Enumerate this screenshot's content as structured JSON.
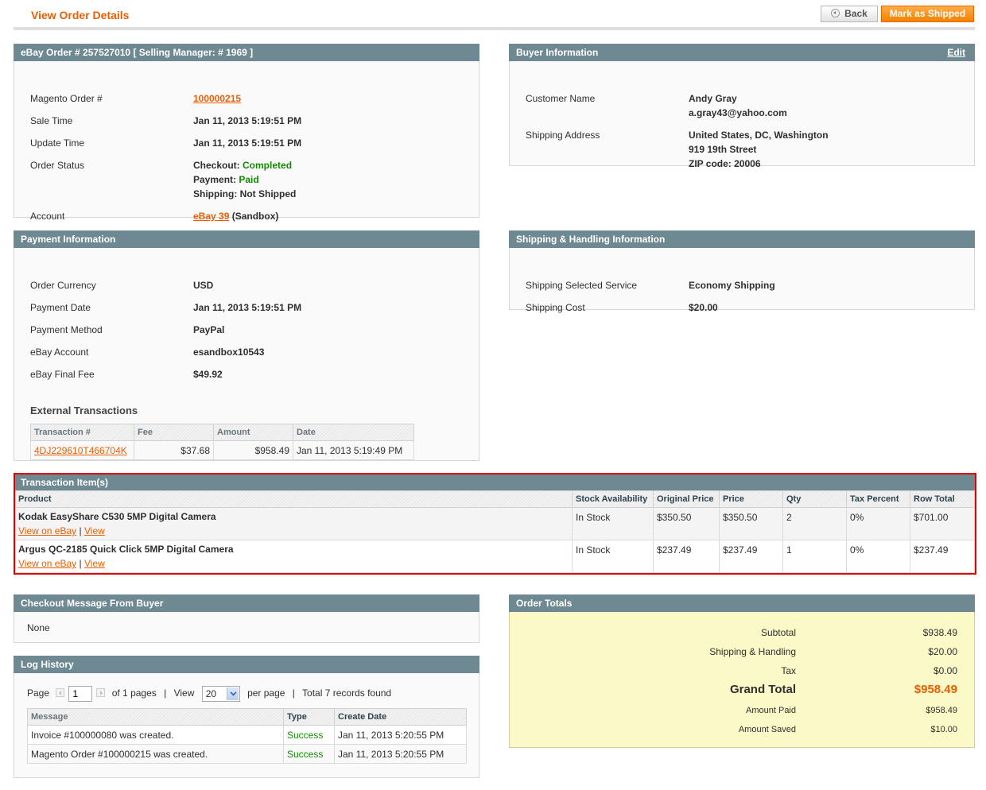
{
  "header": {
    "title": "View Order Details",
    "back_label": "Back",
    "mark_shipped_label": "Mark as Shipped"
  },
  "ebay_order": {
    "title": "eBay Order # 257527010 [ Selling Manager: # 1969 ]",
    "rows": [
      {
        "label": "Magento Order #",
        "value": "100000215"
      },
      {
        "label": "Sale Time",
        "value": "Jan 11, 2013 5:19:51 PM"
      },
      {
        "label": "Update Time",
        "value": "Jan 11, 2013 5:19:51 PM"
      },
      {
        "label": "Order Status"
      },
      {
        "label": "Account"
      }
    ],
    "status": {
      "checkout_label": "Checkout:",
      "checkout_value": "Completed",
      "payment_label": "Payment:",
      "payment_value": "Paid",
      "shipping_label": "Shipping:",
      "shipping_value": "Not Shipped"
    },
    "account_link": "eBay 39",
    "account_mode": "(Sandbox)"
  },
  "buyer": {
    "title": "Buyer Information",
    "edit_label": "Edit",
    "customer_name_label": "Customer Name",
    "customer_name": "Andy Gray",
    "email": "a.gray43@yahoo.com",
    "shipping_address_label": "Shipping Address",
    "address_line1": "United States, DC, Washington",
    "address_line2": "919 19th Street",
    "address_line3": "ZIP code: 20006"
  },
  "payment": {
    "title": "Payment Information",
    "rows": [
      {
        "label": "Order Currency",
        "value": "USD"
      },
      {
        "label": "Payment Date",
        "value": "Jan 11, 2013 5:19:51 PM"
      },
      {
        "label": "Payment Method",
        "value": "PayPal"
      },
      {
        "label": "eBay Account",
        "value": "esandbox10543"
      },
      {
        "label": "eBay Final Fee",
        "value": "$49.92"
      }
    ],
    "external_title": "External Transactions",
    "external_columns": [
      "Transaction #",
      "Fee",
      "Amount",
      "Date"
    ],
    "external_rows": [
      {
        "transaction": "4DJ229610T466704K",
        "fee": "$37.68",
        "amount": "$958.49",
        "date": "Jan 11, 2013 5:19:49 PM"
      }
    ]
  },
  "shipping": {
    "title": "Shipping & Handling Information",
    "service_label": "Shipping Selected Service",
    "service_value": "Economy Shipping",
    "cost_label": "Shipping Cost",
    "cost_value": "$20.00"
  },
  "items": {
    "title": "Transaction Item(s)",
    "columns": [
      "Product",
      "Stock Availability",
      "Original Price",
      "Price",
      "Qty",
      "Tax Percent",
      "Row Total"
    ],
    "link_ebay": "View on eBay",
    "link_view": "View",
    "link_sep": "|",
    "rows": [
      {
        "product": "Kodak EasyShare C530 5MP Digital Camera",
        "stock": "In Stock",
        "original_price": "$350.50",
        "price": "$350.50",
        "qty": "2",
        "tax": "0%",
        "row_total": "$701.00"
      },
      {
        "product": "Argus QC-2185 Quick Click 5MP Digital Camera",
        "stock": "In Stock",
        "original_price": "$237.49",
        "price": "$237.49",
        "qty": "1",
        "tax": "0%",
        "row_total": "$237.49"
      }
    ]
  },
  "checkout_message": {
    "title": "Checkout Message From Buyer",
    "text": "None"
  },
  "log": {
    "title": "Log History",
    "page_label": "Page",
    "page_value": "1",
    "of_pages": "of 1 pages",
    "view_label": "View",
    "per_page_value": "20",
    "per_page_label": "per page",
    "total_records": "Total 7 records found",
    "columns": [
      "Message",
      "Type",
      "Create Date"
    ],
    "rows": [
      {
        "message": "Invoice #100000080 was created.",
        "type": "Success",
        "date": "Jan 11, 2013 5:20:55 PM"
      },
      {
        "message": "Magento Order #100000215 was created.",
        "type": "Success",
        "date": "Jan 11, 2013 5:20:55 PM"
      }
    ]
  },
  "totals": {
    "title": "Order Totals",
    "subtotal_label": "Subtotal",
    "subtotal": "$938.49",
    "shipping_label": "Shipping & Handling",
    "shipping": "$20.00",
    "tax_label": "Tax",
    "tax": "$0.00",
    "grand_label": "Grand Total",
    "grand": "$958.49",
    "paid_label": "Amount Paid",
    "paid": "$958.49",
    "saved_label": "Amount Saved",
    "saved": "$10.00"
  },
  "colors": {
    "accent": "#eb5e00",
    "box_header": "#6f8992",
    "success": "#118c00",
    "highlight_border": "#e00000",
    "totals_bg": "#fbf9c7"
  }
}
